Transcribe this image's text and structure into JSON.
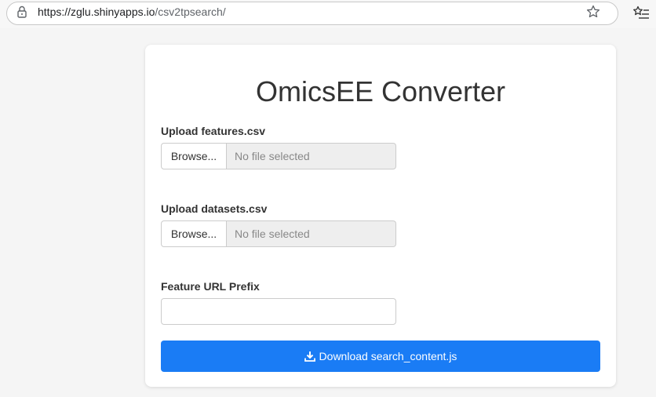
{
  "browser": {
    "url_host": "https://zglu.shinyapps.io",
    "url_path": "/csv2tpsearch/",
    "icons": [
      "lock-icon",
      "star-icon",
      "favorites-icon"
    ]
  },
  "app": {
    "title": "OmicsEE Converter",
    "features_upload": {
      "label": "Upload features.csv",
      "browse_label": "Browse...",
      "status": "No file selected"
    },
    "datasets_upload": {
      "label": "Upload datasets.csv",
      "browse_label": "Browse...",
      "status": "No file selected"
    },
    "url_prefix": {
      "label": "Feature URL Prefix",
      "value": ""
    },
    "download_button": {
      "label": "Download search_content.js",
      "icon": "download-icon",
      "color": "#1a7cf5"
    }
  }
}
